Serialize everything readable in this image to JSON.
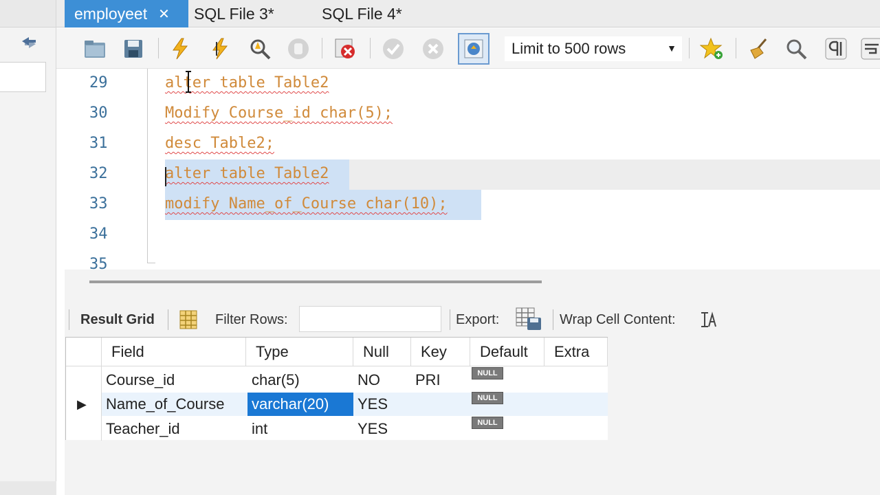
{
  "tabs": [
    {
      "label": "employeet",
      "active": true
    },
    {
      "label": "SQL File 3*",
      "active": false
    },
    {
      "label": "SQL File 4*",
      "active": false
    }
  ],
  "tab_close_glyph": "✕",
  "toolbar": {
    "icons": [
      "open-folder-icon",
      "save-icon",
      "execute-icon",
      "execute-current-icon",
      "explain-icon",
      "stop-icon",
      "toggle-error-icon",
      "commit-icon",
      "rollback-icon",
      "autocommit-icon",
      "beautify-star-icon",
      "broom-icon",
      "find-icon",
      "invisibles-icon",
      "wrap-icon"
    ],
    "limit_label": "Limit to 500 rows"
  },
  "editor": {
    "lines": [
      {
        "num": "29",
        "text": "alter table Table2"
      },
      {
        "num": "30",
        "text": "Modify Course_id char(5);"
      },
      {
        "num": "31",
        "text": "desc Table2;"
      },
      {
        "num": "32",
        "text": "alter table Table2"
      },
      {
        "num": "33",
        "text": "modify Name_of_Course char(10);"
      },
      {
        "num": "34",
        "text": ""
      },
      {
        "num": "35",
        "text": ""
      }
    ]
  },
  "results": {
    "result_grid_label": "Result Grid",
    "filter_rows_label": "Filter Rows:",
    "filter_value": "",
    "export_label": "Export:",
    "wrap_label": "Wrap Cell Content:",
    "columns": [
      "Field",
      "Type",
      "Null",
      "Key",
      "Default",
      "Extra"
    ],
    "rows": [
      {
        "field": "Course_id",
        "type": "char(5)",
        "null": "NO",
        "key": "PRI",
        "default": "NULL",
        "extra": ""
      },
      {
        "field": "Name_of_Course",
        "type": "varchar(20)",
        "null": "YES",
        "key": "",
        "default": "NULL",
        "extra": ""
      },
      {
        "field": "Teacher_id",
        "type": "int",
        "null": "YES",
        "key": "",
        "default": "NULL",
        "extra": ""
      }
    ],
    "row_indicator": "▶"
  },
  "colors": {
    "active_tab": "#3d8fd6",
    "keyword": "#d08a3a",
    "selection": "#cfe1f5",
    "cell_selected": "#1a78d4"
  }
}
